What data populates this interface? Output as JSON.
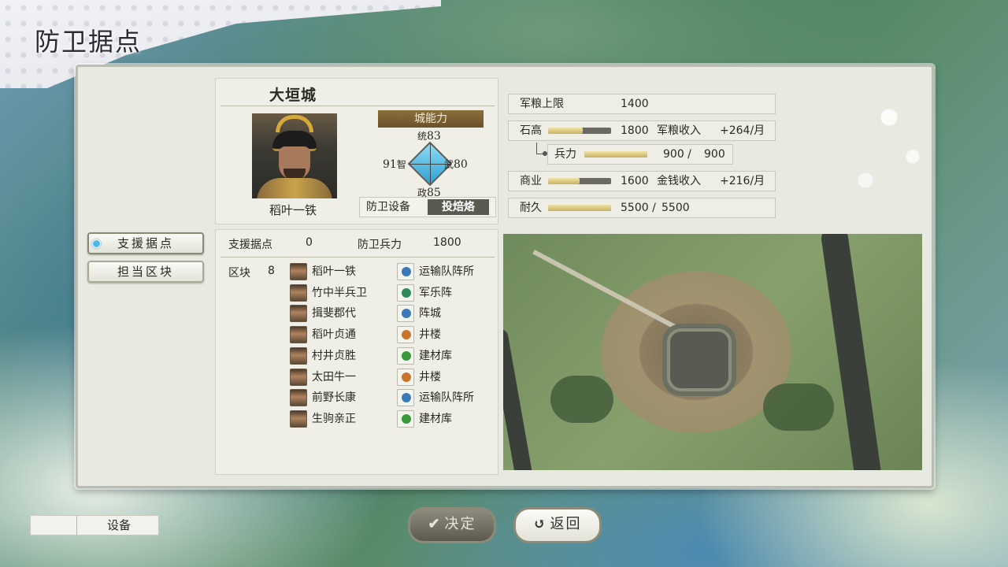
{
  "page": {
    "title": "防卫据点"
  },
  "castle": {
    "name": "大垣城",
    "commander": "稻叶一铁",
    "ability_header": "城能力",
    "stats": {
      "tong_label": "统",
      "tong": "83",
      "zhi_label": "智",
      "zhi": "91",
      "wu_label": "武",
      "wu": "80",
      "zheng_label": "政",
      "zheng": "85"
    },
    "equipment_label": "防卫设备",
    "equipment_value": "投焙烙"
  },
  "resources": {
    "food_cap_label": "军粮上限",
    "food_cap": "1400",
    "rice_label": "石高",
    "rice": "1800",
    "rice_fill": 0.55,
    "food_income_label": "军粮收入",
    "food_income": "+264/月",
    "troops_label": "兵力",
    "troops": "900 /",
    "troops_max": "900",
    "troops_fill": 1.0,
    "commerce_label": "商业",
    "commerce": "1600",
    "commerce_fill": 0.5,
    "gold_income_label": "金钱收入",
    "gold_income": "+216/月",
    "durability_label": "耐久",
    "durability": "5500 /",
    "durability_max": "5500",
    "durability_fill": 1.0
  },
  "side_menu": {
    "support_label": "支援据点",
    "district_label": "担当区块"
  },
  "support": {
    "support_label": "支援据点",
    "support_value": "0",
    "defense_label": "防卫兵力",
    "defense_value": "1800",
    "block_label": "区块",
    "block_value": "8",
    "members": [
      "稻叶一铁",
      "竹中半兵卫",
      "揖斐郡代",
      "稻叶贞通",
      "村井贞胜",
      "太田牛一",
      "前野长康",
      "生驹亲正"
    ],
    "facilities": [
      "运输队阵所",
      "军乐阵",
      "阵城",
      "井楼",
      "建材库",
      "井楼",
      "运输队阵所",
      "建材库"
    ]
  },
  "bottom": {
    "equipment_label": "设备",
    "confirm_label": "决定",
    "back_label": "返回"
  },
  "colors": {
    "accent_blue": "#4db7e8",
    "ability_bar": "#6b5228"
  }
}
